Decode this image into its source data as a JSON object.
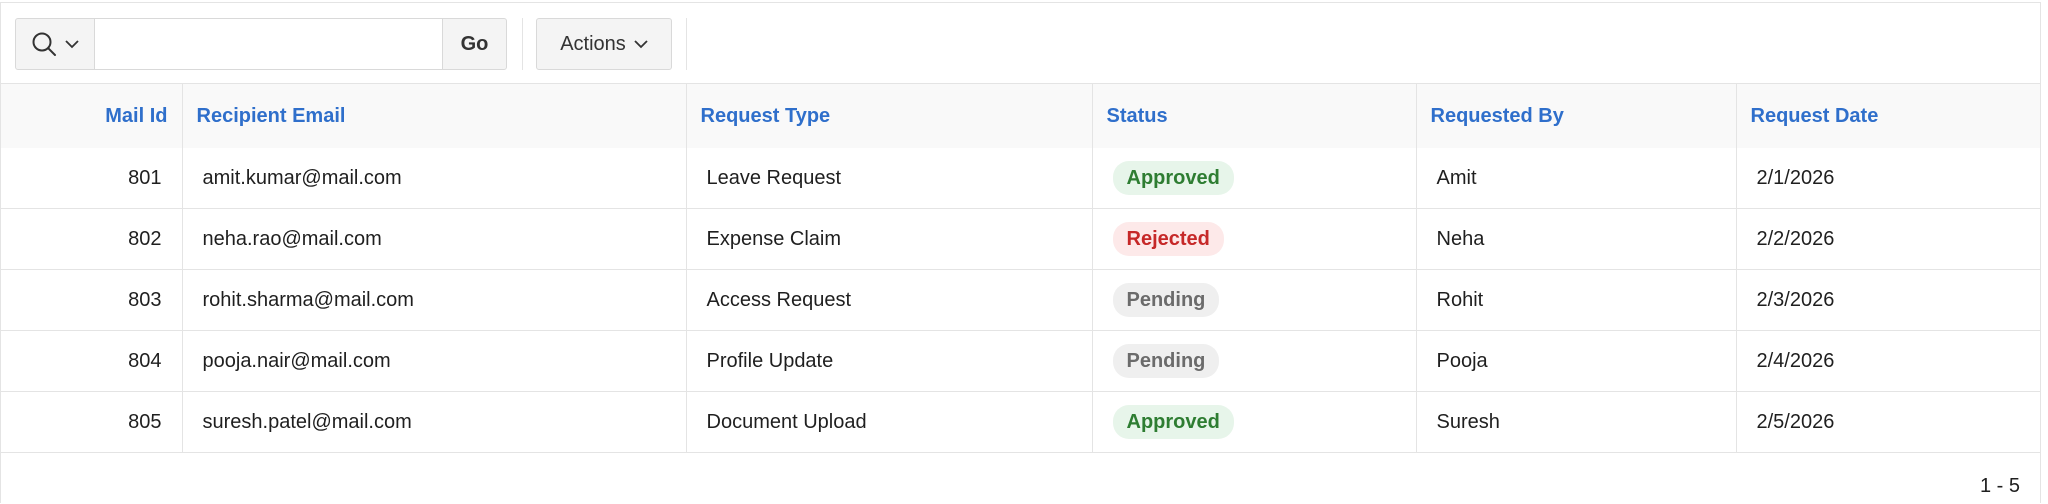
{
  "toolbar": {
    "search_icon": "search-icon",
    "search_value": "",
    "go_label": "Go",
    "actions_label": "Actions"
  },
  "columns": [
    "Mail Id",
    "Recipient Email",
    "Request Type",
    "Status",
    "Requested By",
    "Request Date"
  ],
  "rows": [
    {
      "mail_id": "801",
      "email": "amit.kumar@mail.com",
      "type": "Leave Request",
      "status": "Approved",
      "by": "Amit",
      "date": "2/1/2026"
    },
    {
      "mail_id": "802",
      "email": "neha.rao@mail.com",
      "type": "Expense Claim",
      "status": "Rejected",
      "by": "Neha",
      "date": "2/2/2026"
    },
    {
      "mail_id": "803",
      "email": "rohit.sharma@mail.com",
      "type": "Access Request",
      "status": "Pending",
      "by": "Rohit",
      "date": "2/3/2026"
    },
    {
      "mail_id": "804",
      "email": "pooja.nair@mail.com",
      "type": "Profile Update",
      "status": "Pending",
      "by": "Pooja",
      "date": "2/4/2026"
    },
    {
      "mail_id": "805",
      "email": "suresh.patel@mail.com",
      "type": "Document Upload",
      "status": "Approved",
      "by": "Suresh",
      "date": "2/5/2026"
    }
  ],
  "status_colors": {
    "Approved": {
      "bg": "#e7f5ea",
      "fg": "#2e7d32"
    },
    "Rejected": {
      "bg": "#fde9e9",
      "fg": "#c62828"
    },
    "Pending": {
      "bg": "#efefef",
      "fg": "#6b6b6b"
    }
  },
  "pagination": "1 - 5"
}
